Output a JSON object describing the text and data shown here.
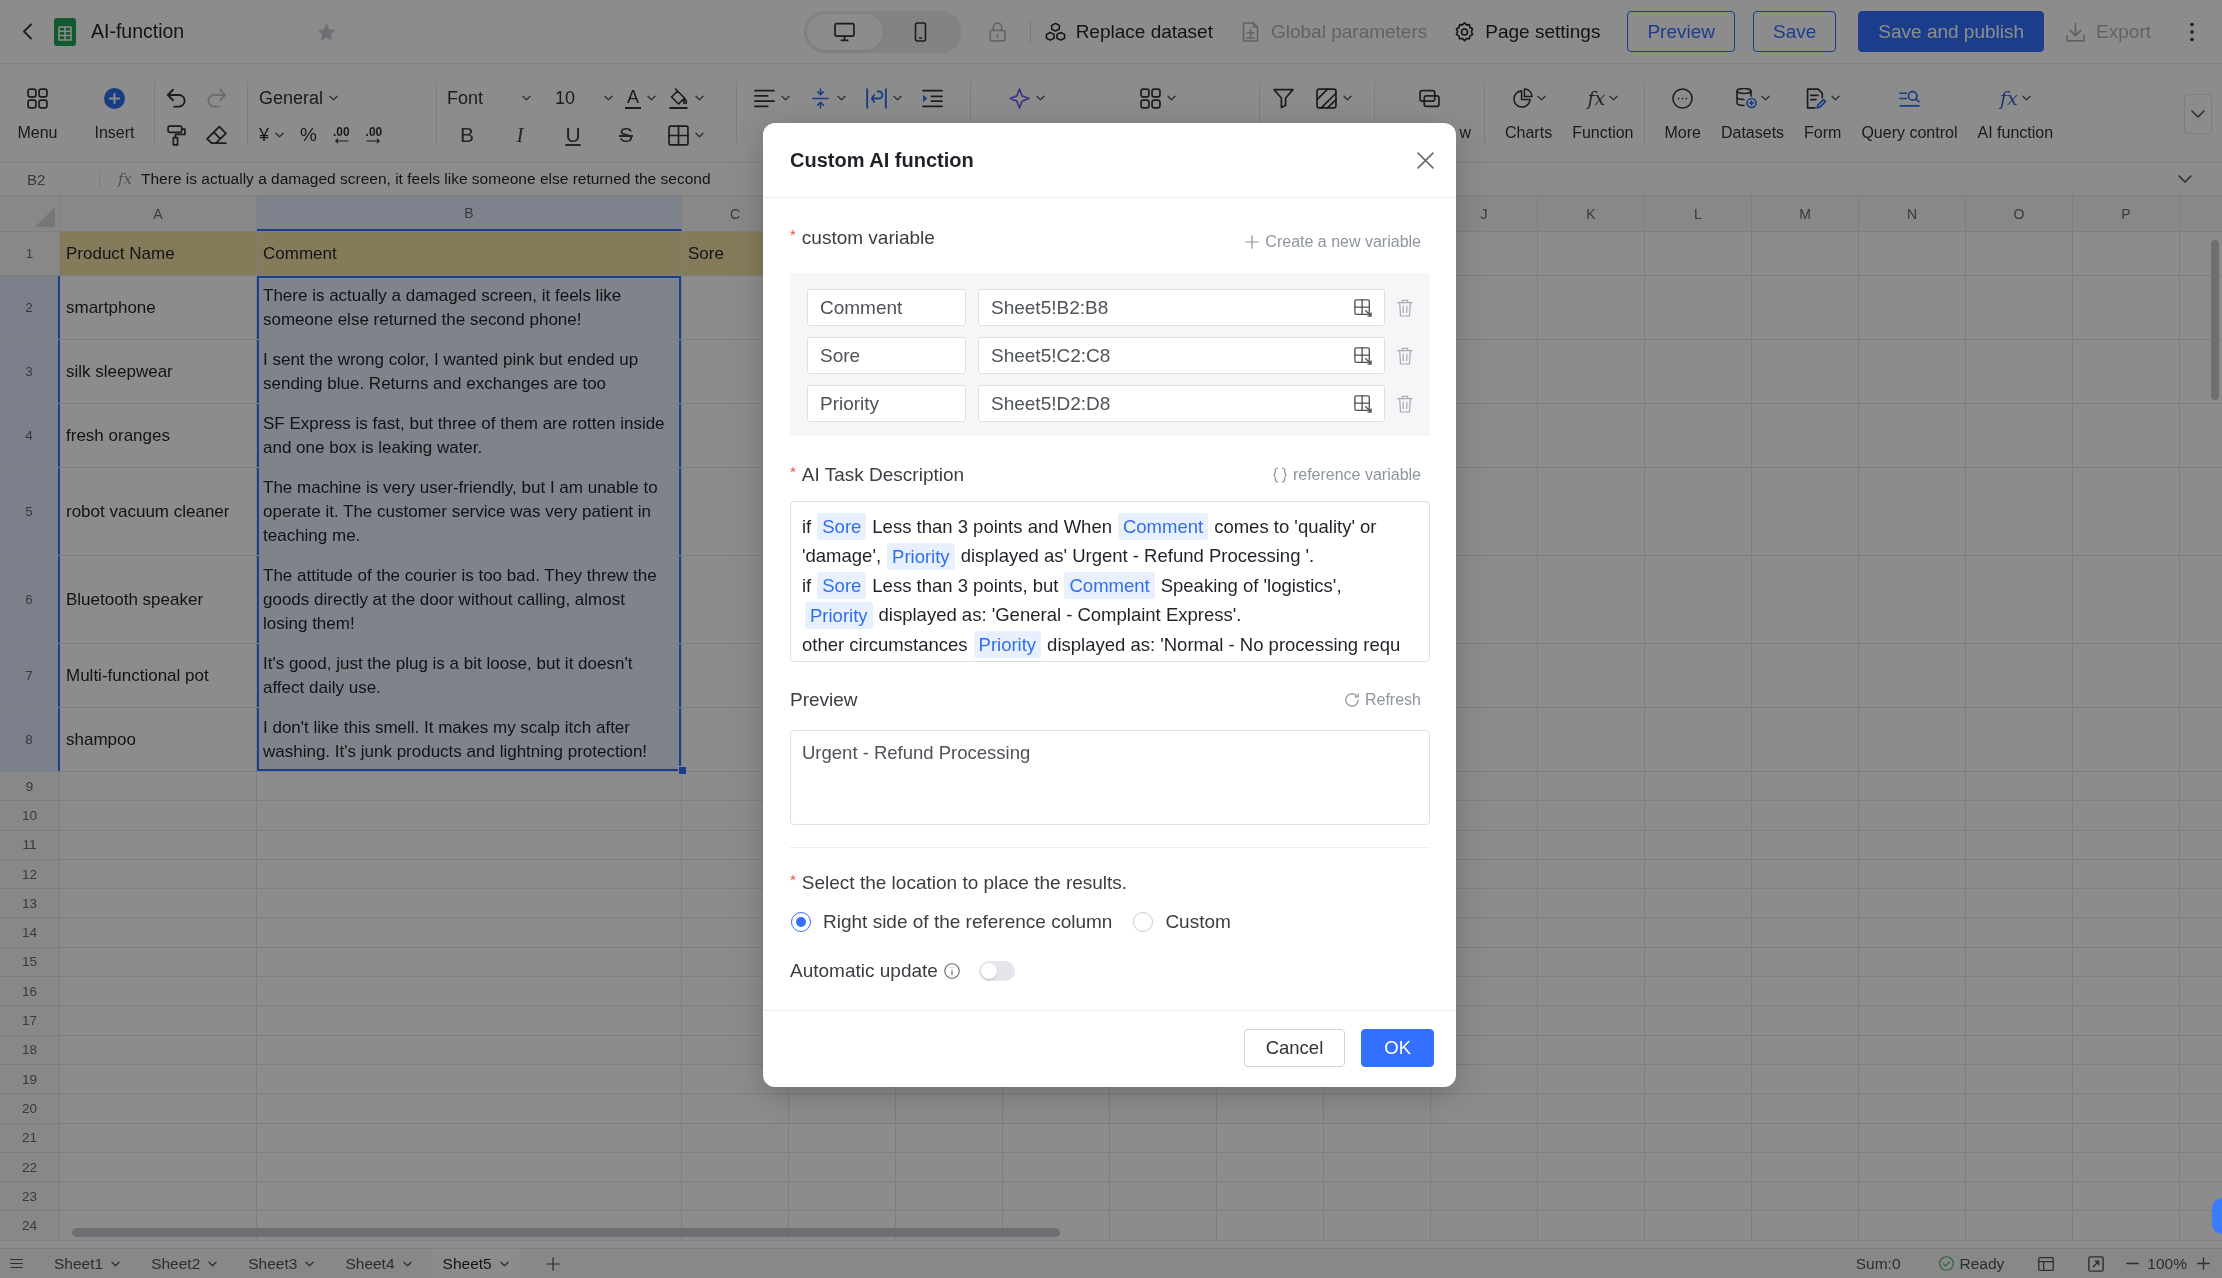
{
  "app_bar": {
    "title": "AI-function",
    "starred": false,
    "view_modes": [
      {
        "selected": true
      },
      {
        "selected": false
      }
    ],
    "actions": [
      {
        "label": "Replace dataset",
        "disabled": false
      },
      {
        "label": "Global parameters",
        "disabled": true
      },
      {
        "label": "Page settings",
        "disabled": false
      }
    ],
    "buttons": [
      {
        "label": "Preview",
        "kind": "outline"
      },
      {
        "label": "Save",
        "kind": "outline"
      },
      {
        "label": "Save and publish",
        "kind": "primary"
      }
    ],
    "export": {
      "label": "Export",
      "disabled": true
    }
  },
  "toolbar": {
    "left_buttons": [
      {
        "label": "Menu"
      },
      {
        "label": "Insert"
      }
    ],
    "history": [
      {
        "disabled": false
      },
      {
        "disabled": true
      }
    ],
    "number_format": "General",
    "currency": "¥",
    "percent": "%",
    "decimals": [
      ".00",
      ".00"
    ],
    "font": "Font",
    "font_size": "10",
    "font_color_letter": "A",
    "text_styles": [
      "B",
      "I",
      "U",
      "S"
    ],
    "cut_label": "w",
    "right_buttons": [
      {
        "label": "Charts",
        "dropdown": true
      },
      {
        "label": "Function",
        "glyph": "fx",
        "dropdown": true
      },
      {
        "label": "More",
        "dropdown": false
      },
      {
        "label": "Datasets",
        "dropdown": true
      },
      {
        "label": "Form",
        "dropdown": true
      },
      {
        "label": "Query control",
        "dropdown": false
      },
      {
        "label": "AI function",
        "glyph": "fx",
        "dropdown": true
      }
    ]
  },
  "formula_bar": {
    "cell": "B2",
    "fx": "fx",
    "formula": "There is actually a damaged screen, it feels like someone else returned the second"
  },
  "sheet": {
    "columns_left": [
      {
        "letter": "A",
        "selected": false
      },
      {
        "letter": "B",
        "selected": true
      },
      {
        "letter": "C",
        "selected": false
      }
    ],
    "columns_right": [
      {
        "letter": "J",
        "selected": false
      },
      {
        "letter": "K",
        "selected": false
      },
      {
        "letter": "L",
        "selected": false
      },
      {
        "letter": "M",
        "selected": false
      },
      {
        "letter": "N",
        "selected": false
      },
      {
        "letter": "O",
        "selected": false
      },
      {
        "letter": "P",
        "selected": false
      }
    ],
    "rows": [
      {
        "number": "1",
        "kind": "header",
        "selected": false,
        "cells": [
          "Product Name",
          "Comment",
          "Sore"
        ]
      },
      {
        "number": "2",
        "kind": "data",
        "selected": true,
        "cells": [
          "smartphone",
          "There is actually a damaged screen, it feels like someone else returned the second phone!"
        ]
      },
      {
        "number": "3",
        "kind": "data",
        "selected": true,
        "cells": [
          "silk sleepwear",
          "I sent the wrong color, I wanted pink but ended up sending blue. Returns and exchanges are too"
        ]
      },
      {
        "number": "4",
        "kind": "data",
        "selected": true,
        "cells": [
          "fresh oranges",
          "SF Express is fast, but three of them are rotten inside and one box is leaking water."
        ]
      },
      {
        "number": "5",
        "kind": "data",
        "selected": true,
        "cells": [
          "robot vacuum cleaner",
          "The machine is very user-friendly, but I am unable to operate it. The customer service was very patient in teaching me."
        ]
      },
      {
        "number": "6",
        "kind": "data",
        "selected": true,
        "cells": [
          "Bluetooth speaker",
          "The attitude of the courier is too bad. They threw the goods directly at the door without calling, almost losing them!"
        ]
      },
      {
        "number": "7",
        "kind": "data",
        "selected": true,
        "cells": [
          "Multi-functional pot",
          "It's good, just the plug is a bit loose, but it doesn't affect daily use."
        ]
      },
      {
        "number": "8",
        "kind": "data",
        "selected": true,
        "cells": [
          "shampoo",
          "I don't like this smell. It makes my scalp itch after washing. It's junk products and lightning protection!"
        ]
      },
      {
        "number": "9",
        "kind": "empty",
        "selected": false
      },
      {
        "number": "10",
        "kind": "empty",
        "selected": false
      },
      {
        "number": "11",
        "kind": "empty",
        "selected": false
      },
      {
        "number": "12",
        "kind": "empty",
        "selected": false
      },
      {
        "number": "13",
        "kind": "empty",
        "selected": false
      },
      {
        "number": "14",
        "kind": "empty",
        "selected": false
      },
      {
        "number": "15",
        "kind": "empty",
        "selected": false
      },
      {
        "number": "16",
        "kind": "empty",
        "selected": false
      },
      {
        "number": "17",
        "kind": "empty",
        "selected": false
      },
      {
        "number": "18",
        "kind": "empty",
        "selected": false
      },
      {
        "number": "19",
        "kind": "empty",
        "selected": false
      },
      {
        "number": "20",
        "kind": "empty",
        "selected": false
      },
      {
        "number": "21",
        "kind": "empty",
        "selected": false
      },
      {
        "number": "22",
        "kind": "empty",
        "selected": false
      },
      {
        "number": "23",
        "kind": "empty",
        "selected": false
      },
      {
        "number": "24",
        "kind": "empty",
        "selected": false
      }
    ]
  },
  "sheet_tabs": [
    {
      "label": "Sheet1",
      "selected": false
    },
    {
      "label": "Sheet2",
      "selected": false
    },
    {
      "label": "Sheet3",
      "selected": false
    },
    {
      "label": "Sheet4",
      "selected": false
    },
    {
      "label": "Sheet5",
      "selected": true
    }
  ],
  "status_bar": {
    "sum": "Sum:0",
    "status": "Ready",
    "zoom": "100%"
  },
  "dialog": {
    "title": "Custom AI function",
    "variables_section": {
      "marker": "*",
      "label": "custom variable",
      "action": "Create a new variable"
    },
    "variables": [
      {
        "name": "Comment",
        "range": "Sheet5!B2:B8"
      },
      {
        "name": "Sore",
        "range": "Sheet5!C2:C8"
      },
      {
        "name": "Priority",
        "range": "Sheet5!D2:D8"
      }
    ],
    "task_section": {
      "marker": "*",
      "label": "AI Task Description",
      "action": "reference variable"
    },
    "task_lines": [
      {
        "segments": [
          {
            "kind": "text",
            "text": "if"
          },
          {
            "kind": "variable",
            "text": "Sore"
          },
          {
            "kind": "text",
            "text": "Less than 3 points and When"
          },
          {
            "kind": "variable",
            "text": "Comment"
          },
          {
            "kind": "text",
            "text": "comes to 'quality' or"
          }
        ]
      },
      {
        "segments": [
          {
            "kind": "text",
            "text": "'damage',"
          },
          {
            "kind": "variable",
            "text": "Priority"
          },
          {
            "kind": "text",
            "text": "displayed as' Urgent - Refund Processing '."
          }
        ]
      },
      {
        "segments": [
          {
            "kind": "text",
            "text": "if"
          },
          {
            "kind": "variable",
            "text": "Sore"
          },
          {
            "kind": "text",
            "text": "Less than 3 points, but"
          },
          {
            "kind": "variable",
            "text": "Comment"
          },
          {
            "kind": "text",
            "text": "Speaking of 'logistics',"
          }
        ]
      },
      {
        "segments": [
          {
            "kind": "variable",
            "text": "Priority"
          },
          {
            "kind": "text",
            "text": "displayed as: 'General - Complaint Express'."
          }
        ]
      },
      {
        "segments": [
          {
            "kind": "text",
            "text": "other circumstances"
          },
          {
            "kind": "variable",
            "text": "Priority"
          },
          {
            "kind": "text",
            "text": "displayed as: 'Normal - No processing requ"
          }
        ]
      }
    ],
    "preview": {
      "label": "Preview",
      "action": "Refresh",
      "value": "Urgent - Refund Processing"
    },
    "location": {
      "marker": "*",
      "label": "Select the location to place the results.",
      "options": [
        {
          "label": "Right side of the reference column",
          "selected": true
        },
        {
          "label": "Custom",
          "selected": false
        }
      ]
    },
    "auto_update": {
      "label": "Automatic update",
      "on": false
    },
    "buttons": [
      {
        "label": "Cancel",
        "kind": "secondary"
      },
      {
        "label": "OK",
        "kind": "primary"
      }
    ]
  }
}
